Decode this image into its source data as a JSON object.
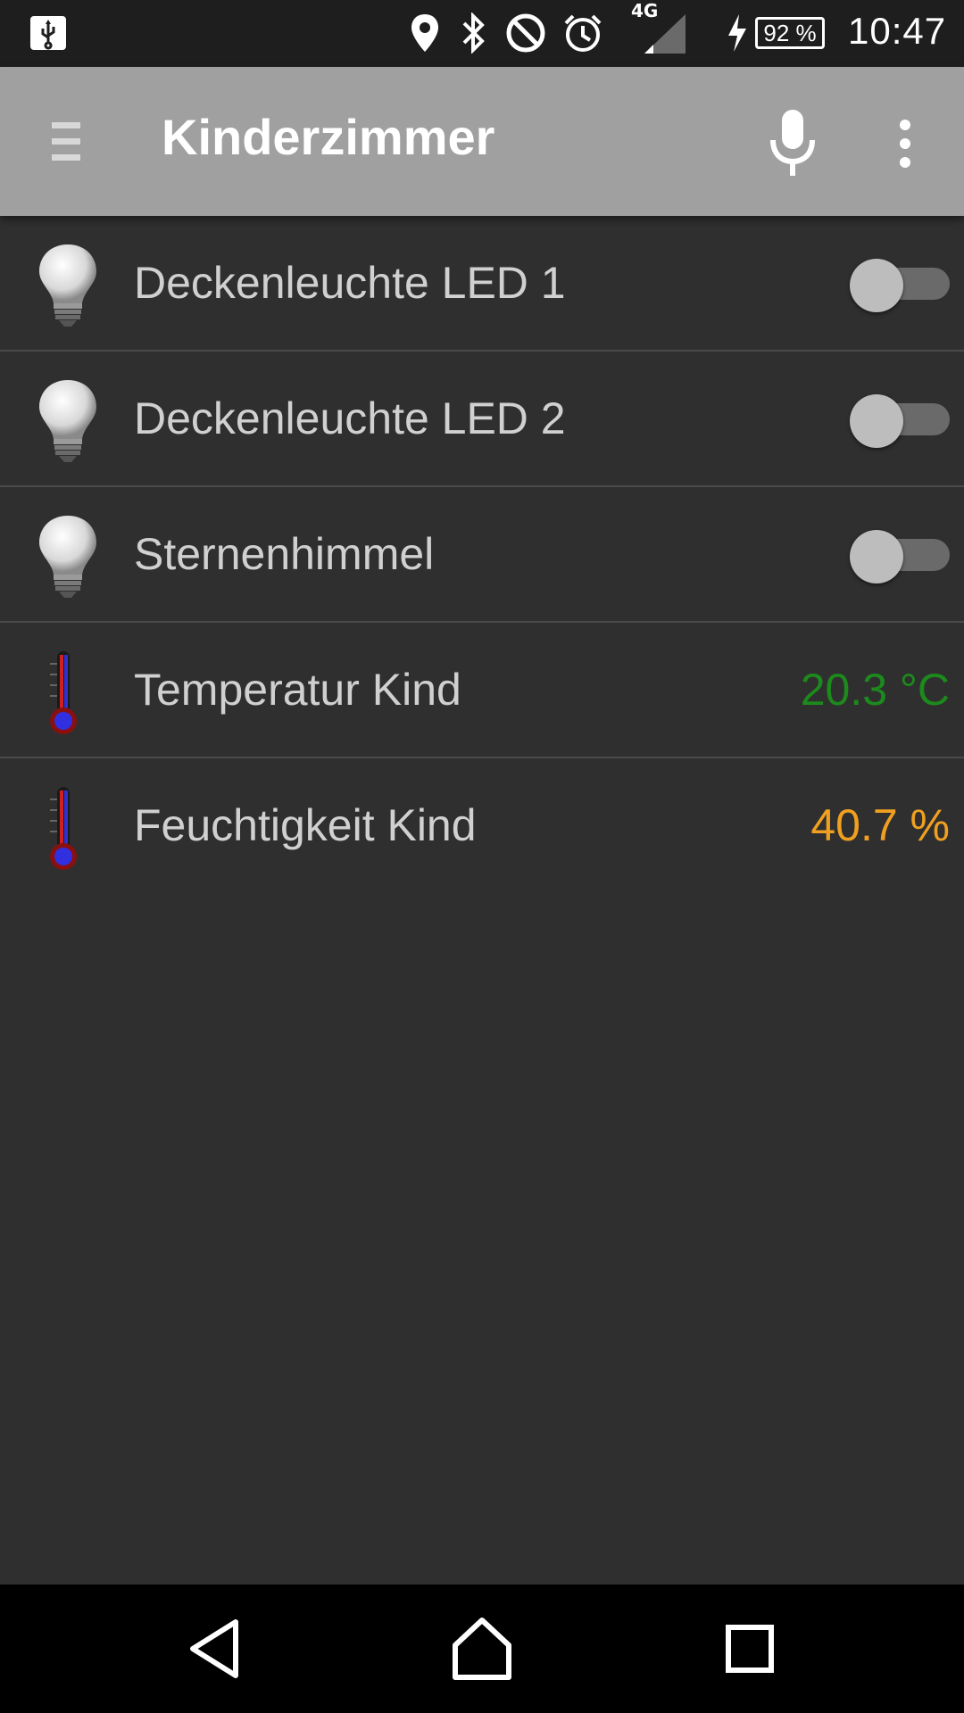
{
  "status_bar": {
    "network_type": "4G",
    "battery_level": "92 %",
    "clock": "10:47",
    "icons": [
      "usb-icon",
      "location-icon",
      "bluetooth-icon",
      "do-not-disturb-icon",
      "alarm-icon",
      "signal-icon",
      "charging-icon",
      "battery-icon"
    ]
  },
  "toolbar": {
    "title": "Kinderzimmer",
    "icons": [
      "menu-icon",
      "microphone-icon",
      "overflow-menu-icon"
    ]
  },
  "items": [
    {
      "label": "Deckenleuchte LED 1",
      "icon": "light-bulb-icon",
      "type": "switch",
      "on": false
    },
    {
      "label": "Deckenleuchte LED 2",
      "icon": "light-bulb-icon",
      "type": "switch",
      "on": false
    },
    {
      "label": "Sternenhimmel",
      "icon": "light-bulb-icon",
      "type": "switch",
      "on": false
    },
    {
      "label": "Temperatur Kind",
      "icon": "thermometer-icon",
      "type": "value",
      "value": "20.3 °C",
      "value_color": "#1c8a1c"
    },
    {
      "label": "Feuchtigkeit Kind",
      "icon": "thermometer-icon",
      "type": "value",
      "value": "40.7 %",
      "value_color": "#f0a020"
    }
  ],
  "nav_bar": {
    "icons": [
      "back-icon",
      "home-icon",
      "recents-icon"
    ]
  },
  "colors": {
    "background": "#2f2f2f",
    "toolbar": "#a0a0a0",
    "divider": "#4a4a4a"
  }
}
